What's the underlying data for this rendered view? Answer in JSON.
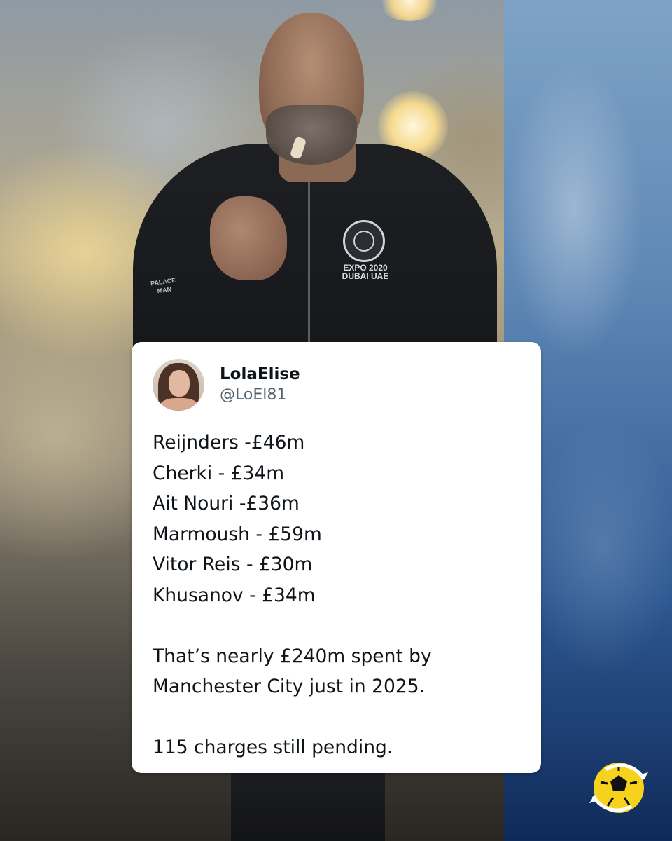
{
  "tweet": {
    "display_name": "LolaElise",
    "handle": "@LoEl81",
    "transfers": [
      "Reijnders -£46m",
      "Cherki - £34m",
      "Ait Nouri -£36m",
      "Marmoush - £59m",
      "Vitor Reis - £30m",
      "Khusanov - £34m"
    ],
    "summary_line_1": "That’s nearly £240m spent by",
    "summary_line_2": "Manchester City just in 2025.",
    "closing": "115 charges still pending."
  },
  "photo": {
    "jacket_text": "EXPO 2020\nDUBAI UAE",
    "sleeve_text": "PALACE\nMAN"
  },
  "colors": {
    "card_bg": "#ffffff",
    "text_primary": "#0f1419",
    "text_secondary": "#536471",
    "logo_yellow": "#f7d21c",
    "logo_ring": "#ffffff"
  },
  "icons": {
    "logo": "football-refresh-icon"
  }
}
